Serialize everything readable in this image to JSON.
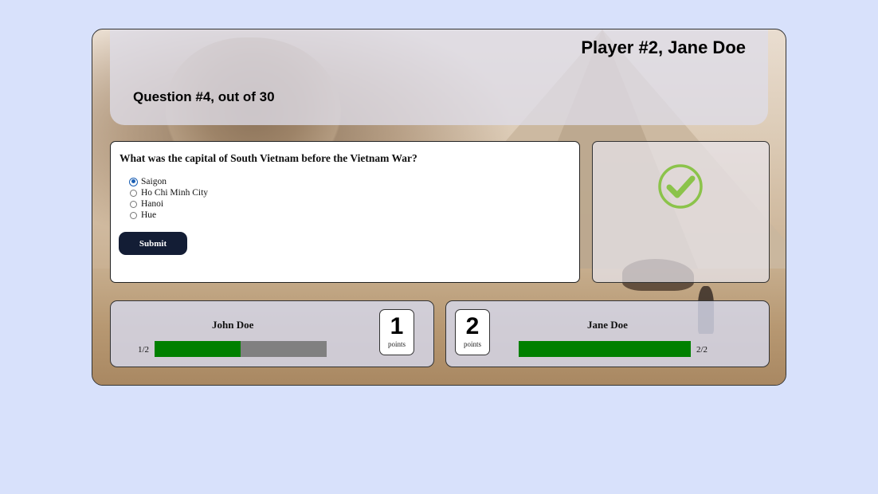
{
  "header": {
    "player_title": "Player #2, Jane Doe",
    "question_counter": "Question #4, out of 30"
  },
  "question": {
    "text": "What was the capital of South Vietnam before the Vietnam War?",
    "options": [
      "Saigon",
      "Ho Chi Minh City",
      "Hanoi",
      "Hue"
    ],
    "selected": "Saigon",
    "submit_label": "Submit"
  },
  "result": {
    "icon": "check-circle-icon",
    "color": "#8bc34a"
  },
  "players": [
    {
      "name": "John Doe",
      "points": "1",
      "points_label": "points",
      "progress_text": "1/2",
      "progress_fraction": 0.5
    },
    {
      "name": "Jane Doe",
      "points": "2",
      "points_label": "points",
      "progress_text": "2/2",
      "progress_fraction": 1.0
    }
  ],
  "colors": {
    "page_background": "#d8e1fb",
    "submit_button": "#131d35",
    "progress_fill": "#008000",
    "progress_track": "#808080"
  }
}
